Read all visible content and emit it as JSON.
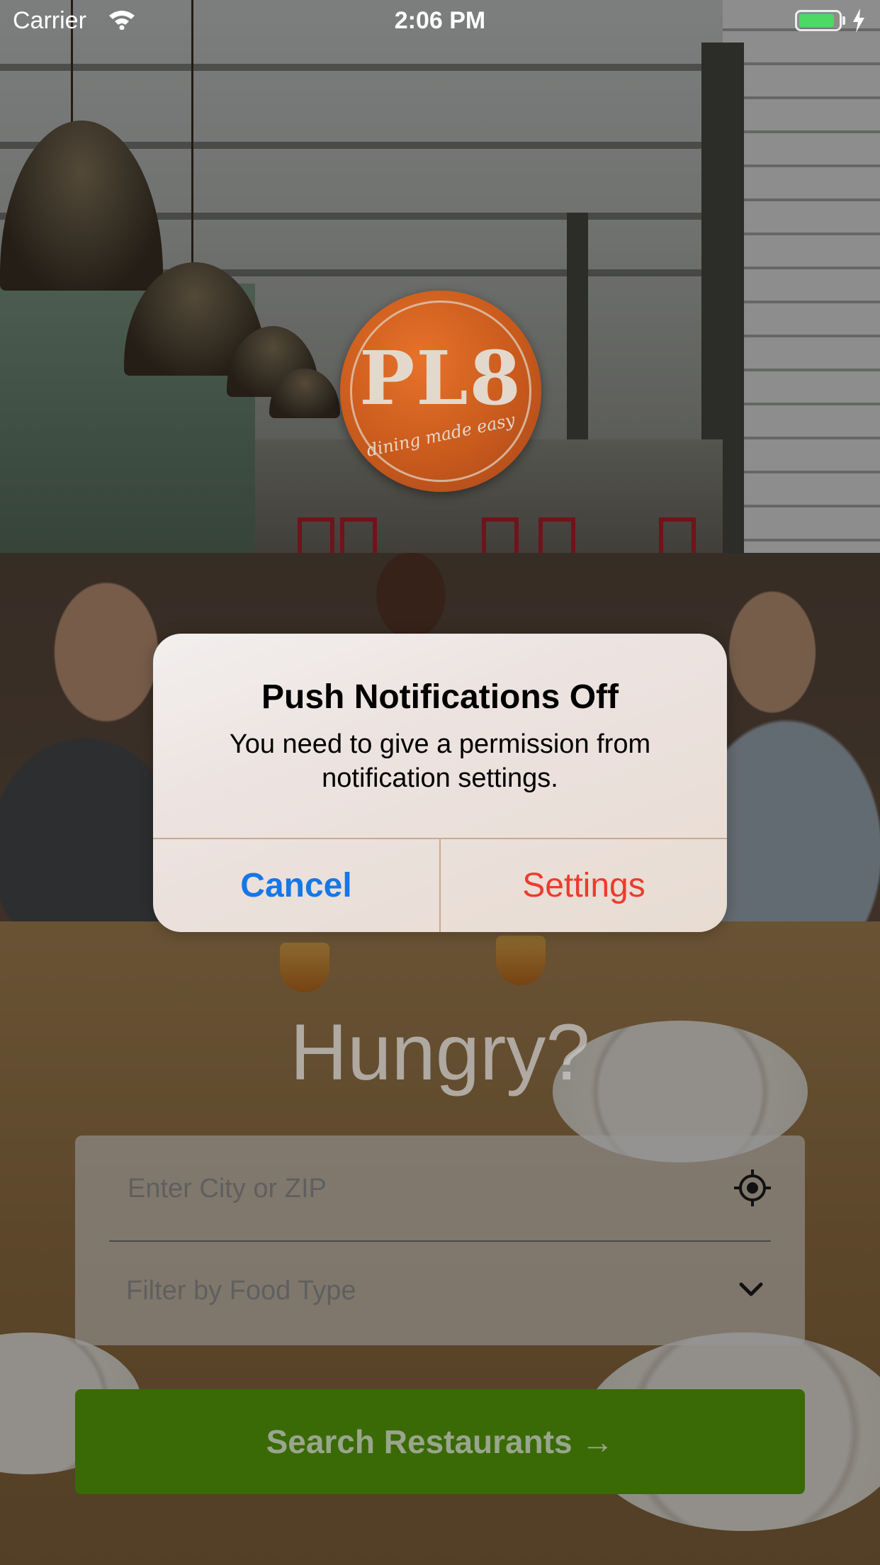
{
  "status_bar": {
    "carrier": "Carrier",
    "time": "2:06 PM",
    "battery_level": 0.9,
    "charging": true
  },
  "logo": {
    "text": "PL8",
    "tagline": "dining made easy"
  },
  "main": {
    "heading": "Hungry?",
    "city_input": {
      "placeholder": "Enter City or ZIP",
      "value": "",
      "icon": "locate-icon"
    },
    "food_filter": {
      "placeholder": "Filter by Food Type",
      "icon": "chevron-down-icon"
    },
    "search_button_label": "Search Restaurants →"
  },
  "alert": {
    "title": "Push Notifications Off",
    "message": "You need to give a permission from notification settings.",
    "cancel_label": "Cancel",
    "settings_label": "Settings"
  },
  "colors": {
    "cancel": "#1677e6",
    "settings": "#ee3b2c",
    "search_button": "#3a6a06",
    "battery": "#4cd964",
    "logo": "#c85a1c"
  }
}
